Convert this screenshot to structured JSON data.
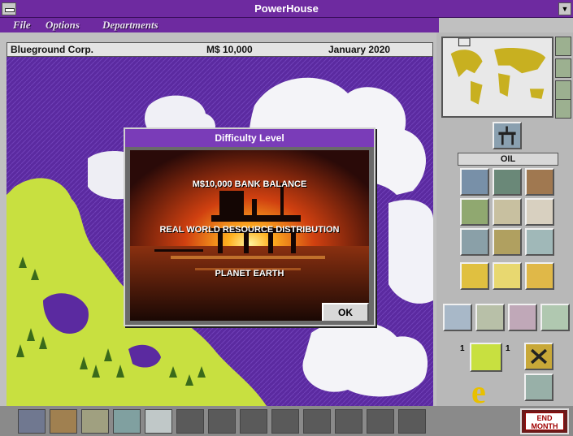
{
  "window": {
    "title": "PowerHouse"
  },
  "menu": {
    "items": [
      "File",
      "Options",
      "Departments"
    ]
  },
  "status": {
    "company": "Blueground Corp.",
    "balance": "M$ 10,000",
    "date": "January 2020"
  },
  "dialog": {
    "title": "Difficulty Level",
    "line1": "M$10,000 BANK BALANCE",
    "line2": "REAL WORLD RESOURCE DISTRIBUTION",
    "line3": "PLANET EARTH",
    "ok_label": "OK"
  },
  "panel": {
    "resource_label": "OIL",
    "counter_left": "1",
    "counter_right": "1",
    "energy_glyph": "e",
    "end_month_line1": "END",
    "end_month_line2": "MONTH"
  },
  "colors": {
    "title_bar": "#6e2aa0",
    "ocean": "#5b2aa0",
    "land": "#c8e040",
    "dialog_title": "#7a3cb8"
  },
  "icons": {
    "system_menu": "system-menu-icon",
    "scroll_down": "scroll-down-icon",
    "world_map": "world-map-icon",
    "oil_rig": "oil-rig-icon",
    "energy": "energy-e-icon"
  }
}
